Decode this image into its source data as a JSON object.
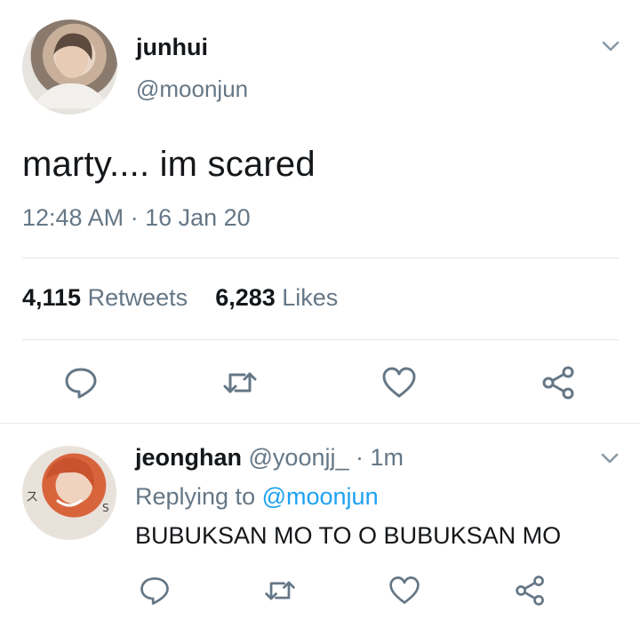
{
  "main_tweet": {
    "display_name": "junhui",
    "handle": "@moonjun",
    "text": "marty.... im scared",
    "timestamp": "12:48 AM · 16 Jan 20",
    "retweets_count": "4,115",
    "retweets_label": "Retweets",
    "likes_count": "6,283",
    "likes_label": "Likes",
    "actions": [
      "reply-icon",
      "retweet-icon",
      "like-icon",
      "share-icon"
    ]
  },
  "reply_tweet": {
    "display_name": "jeonghan",
    "handle": "@yoonjj_",
    "time": "· 1m",
    "replying_prefix": "Replying to",
    "replying_handle": "@moonjun",
    "text": "BUBUKSAN MO TO O BUBUKSAN MO",
    "actions": [
      "reply-icon",
      "retweet-icon",
      "like-icon",
      "share-icon"
    ]
  },
  "colors": {
    "text": "#14171a",
    "muted": "#657786",
    "link": "#1da1f2",
    "divider": "#e1e8ed"
  }
}
